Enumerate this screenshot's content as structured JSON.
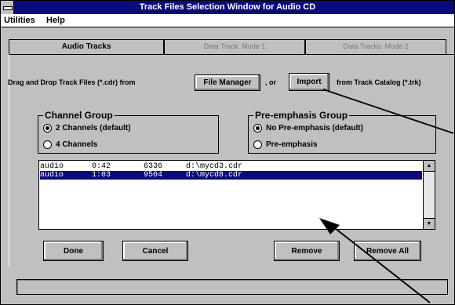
{
  "window": {
    "title": "Track Files Selection Window for Audio CD"
  },
  "menu": {
    "items": [
      "Utilities",
      "Help"
    ]
  },
  "tabs": [
    "Audio Tracks",
    "Data Track: Mode 1",
    "Data Tracks: Mode 2"
  ],
  "instruction": {
    "prefix": "Drag and Drop Track Files (*.cdr) from",
    "file_manager_button": "File Manager",
    "or": ", or",
    "import_button": "Import",
    "suffix": "from Track Catalog (*.trk)"
  },
  "channel_group": {
    "title": "Channel Group",
    "options": [
      {
        "label": "2 Channels (default)",
        "selected": true
      },
      {
        "label": "4 Channels",
        "selected": false
      }
    ]
  },
  "preemphasis_group": {
    "title": "Pre-emphasis Group",
    "options": [
      {
        "label": "No Pre-emphasis (default)",
        "selected": true
      },
      {
        "label": "Pre-emphasis",
        "selected": false
      }
    ]
  },
  "track_list": {
    "rows": [
      {
        "type": "audio",
        "duration": "0:42",
        "size": "6336",
        "path": "d:\\mycd3.cdr",
        "selected": false
      },
      {
        "type": "audio",
        "duration": "1:03",
        "size": "9504",
        "path": "d:\\mycd8.cdr",
        "selected": true
      }
    ]
  },
  "buttons": {
    "done": "Done",
    "cancel": "Cancel",
    "remove": "Remove",
    "remove_all": "Remove All"
  },
  "scrollbar": {
    "up_icon": "▲",
    "down_icon": "▼"
  }
}
